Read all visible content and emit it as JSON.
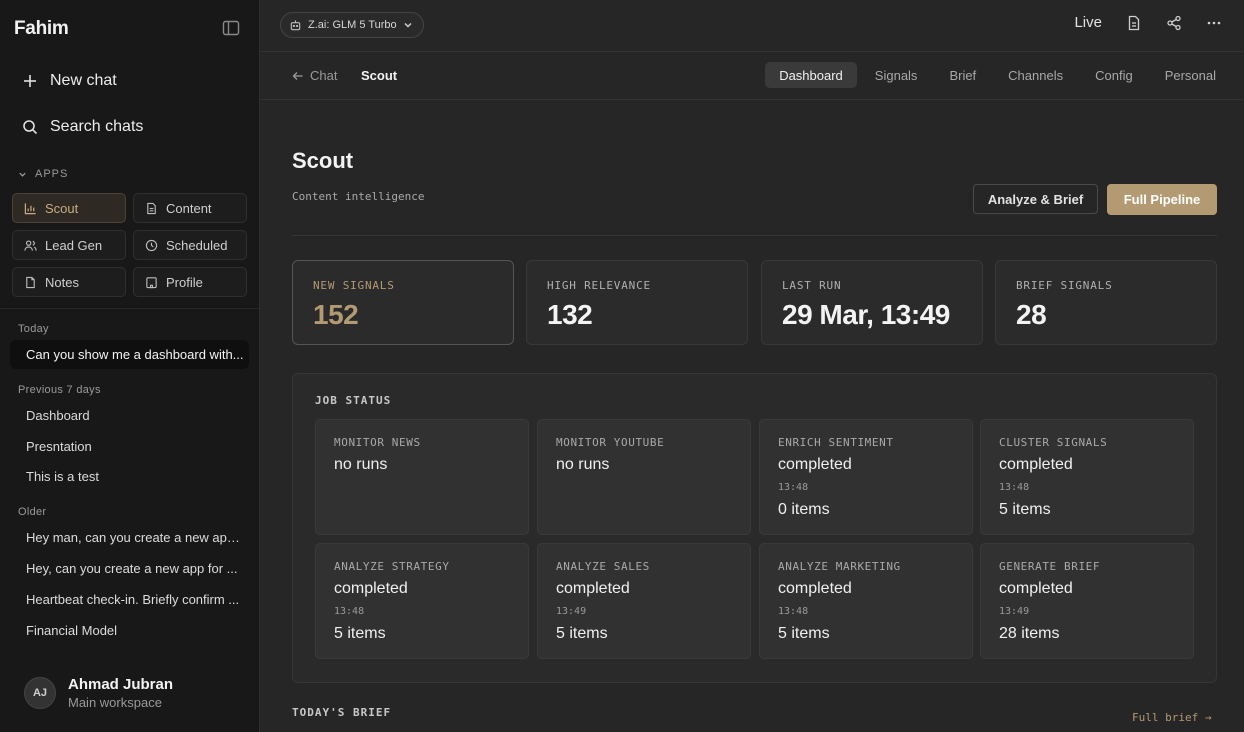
{
  "sidebar": {
    "brand": "Fahim",
    "new_chat": "New chat",
    "search_chats": "Search chats",
    "apps_label": "APPS",
    "apps": [
      {
        "label": "Scout",
        "icon": "bar-chart-icon"
      },
      {
        "label": "Content",
        "icon": "document-icon"
      },
      {
        "label": "Lead Gen",
        "icon": "users-icon"
      },
      {
        "label": "Scheduled",
        "icon": "clock-icon"
      },
      {
        "label": "Notes",
        "icon": "file-icon"
      },
      {
        "label": "Profile",
        "icon": "building-icon"
      }
    ],
    "sections": {
      "today": {
        "label": "Today",
        "items": [
          "Can you show me a dashboard with..."
        ]
      },
      "previous": {
        "label": "Previous 7 days",
        "items": [
          "Dashboard",
          "Presntation",
          "This is a test"
        ]
      },
      "older": {
        "label": "Older",
        "items": [
          "Hey man, can you create a new app...",
          "Hey, can you create a new app for ...",
          "Heartbeat check-in. Briefly confirm ...",
          "Financial Model"
        ]
      }
    },
    "user": {
      "initials": "AJ",
      "name": "Ahmad Jubran",
      "workspace": "Main workspace"
    }
  },
  "topbar": {
    "model": "Z.ai: GLM 5 Turbo",
    "live": "Live"
  },
  "subnav": {
    "back": "Chat",
    "current": "Scout",
    "tabs": [
      "Dashboard",
      "Signals",
      "Brief",
      "Channels",
      "Config",
      "Personal"
    ],
    "active_tab": "Dashboard"
  },
  "main": {
    "title": "Scout",
    "subtitle": "Content intelligence",
    "analyze_button": "Analyze & Brief",
    "pipeline_button": "Full Pipeline",
    "stats": [
      {
        "label": "NEW SIGNALS",
        "value": "152"
      },
      {
        "label": "HIGH RELEVANCE",
        "value": "132"
      },
      {
        "label": "LAST RUN",
        "value": "29 Mar, 13:49"
      },
      {
        "label": "BRIEF SIGNALS",
        "value": "28"
      }
    ],
    "job_status_label": "JOB STATUS",
    "jobs": [
      {
        "name": "MONITOR NEWS",
        "status": "no runs",
        "time": "",
        "items": ""
      },
      {
        "name": "MONITOR YOUTUBE",
        "status": "no runs",
        "time": "",
        "items": ""
      },
      {
        "name": "ENRICH SENTIMENT",
        "status": "completed",
        "time": "13:48",
        "items": "0 items"
      },
      {
        "name": "CLUSTER SIGNALS",
        "status": "completed",
        "time": "13:48",
        "items": "5 items"
      },
      {
        "name": "ANALYZE STRATEGY",
        "status": "completed",
        "time": "13:48",
        "items": "5 items"
      },
      {
        "name": "ANALYZE SALES",
        "status": "completed",
        "time": "13:49",
        "items": "5 items"
      },
      {
        "name": "ANALYZE MARKETING",
        "status": "completed",
        "time": "13:48",
        "items": "5 items"
      },
      {
        "name": "GENERATE BRIEF",
        "status": "completed",
        "time": "13:49",
        "items": "28 items"
      }
    ],
    "brief_label": "TODAY'S BRIEF",
    "brief_link": "Full brief →"
  },
  "colors": {
    "accent": "#b39a73",
    "background": "#262626",
    "sidebar": "#181818"
  }
}
